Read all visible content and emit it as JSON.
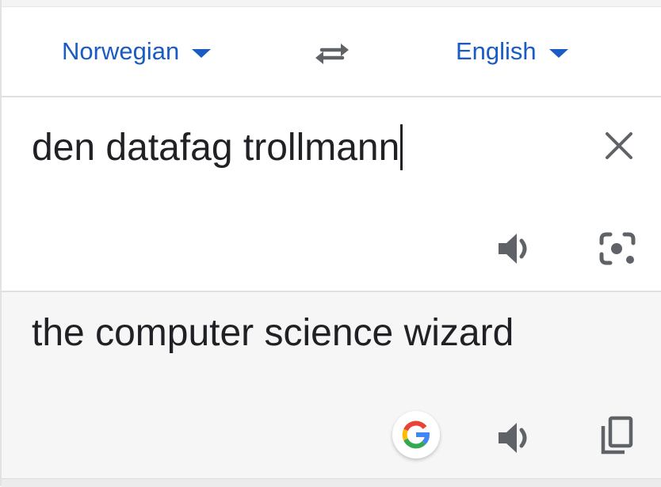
{
  "language_bar": {
    "source_language": "Norwegian",
    "target_language": "English",
    "swap_icon": "swap-arrows-icon",
    "dropdown_icon": "caret-down-icon"
  },
  "input": {
    "text": "den datafag trollmann",
    "clear_icon": "close-icon",
    "speaker_icon": "speaker-icon",
    "camera_icon": "camera-lens-icon"
  },
  "output": {
    "text": "the computer science wizard",
    "google_icon": "google-logo-icon",
    "speaker_icon": "speaker-icon",
    "copy_icon": "copy-icon"
  },
  "colors": {
    "accent": "#1a5bc4",
    "text": "#202124",
    "icon": "#5f6368",
    "output_background": "#f6f6f6"
  }
}
